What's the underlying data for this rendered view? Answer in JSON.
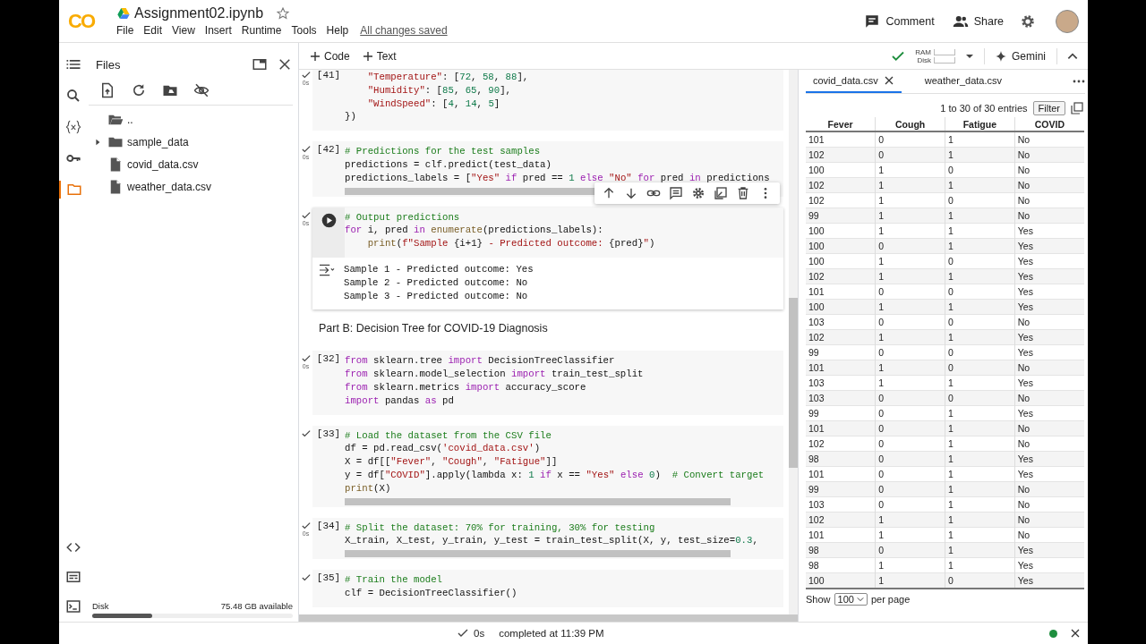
{
  "header": {
    "logo": "CO",
    "title": "Assignment02.ipynb",
    "starred": false,
    "menus": [
      "File",
      "Edit",
      "View",
      "Insert",
      "Runtime",
      "Tools",
      "Help"
    ],
    "save_status": "All changes saved",
    "actions": [
      "Comment",
      "Share"
    ]
  },
  "rail": {
    "items": [
      {
        "selected": false
      },
      {
        "selected": false
      },
      {
        "selected": false
      },
      {
        "selected": true
      }
    ]
  },
  "files": {
    "title": "Files",
    "items": [
      {
        "kind": "parent",
        "name": ".."
      },
      {
        "kind": "folder",
        "name": "sample_data",
        "expanded": false
      },
      {
        "kind": "file",
        "name": "covid_data.csv"
      },
      {
        "kind": "file",
        "name": "weather_data.csv"
      }
    ],
    "disk": {
      "label": "Disk",
      "available": "75.48 GB available",
      "level": 0.3
    }
  },
  "toolbar": {
    "add_buttons": [
      "Code",
      "Text"
    ],
    "connected": true,
    "resources": [
      "RAM",
      "Disk"
    ],
    "gemini": "Gemini"
  },
  "cells": [
    {
      "kind": "code",
      "count": "[41]",
      "time": "0s",
      "ran": true,
      "active": false,
      "hscroll": false,
      "lines": [
        [
          {
            "kind": "string",
            "text": "    \"Temperature\""
          },
          {
            "kind": "plain",
            "text": ": ["
          },
          {
            "kind": "number",
            "text": "72"
          },
          {
            "kind": "plain",
            "text": ", "
          },
          {
            "kind": "number",
            "text": "58"
          },
          {
            "kind": "plain",
            "text": ", "
          },
          {
            "kind": "number",
            "text": "88"
          },
          {
            "kind": "plain",
            "text": "],"
          }
        ],
        [
          {
            "kind": "string",
            "text": "    \"Humidity\""
          },
          {
            "kind": "plain",
            "text": ": ["
          },
          {
            "kind": "number",
            "text": "85"
          },
          {
            "kind": "plain",
            "text": ", "
          },
          {
            "kind": "number",
            "text": "65"
          },
          {
            "kind": "plain",
            "text": ", "
          },
          {
            "kind": "number",
            "text": "90"
          },
          {
            "kind": "plain",
            "text": "],"
          }
        ],
        [
          {
            "kind": "string",
            "text": "    \"WindSpeed\""
          },
          {
            "kind": "plain",
            "text": ": ["
          },
          {
            "kind": "number",
            "text": "4"
          },
          {
            "kind": "plain",
            "text": ", "
          },
          {
            "kind": "number",
            "text": "14"
          },
          {
            "kind": "plain",
            "text": ", "
          },
          {
            "kind": "number",
            "text": "5"
          },
          {
            "kind": "plain",
            "text": "]"
          }
        ],
        [
          {
            "kind": "plain",
            "text": "})"
          }
        ]
      ]
    },
    {
      "kind": "code",
      "count": "[42]",
      "time": "0s",
      "ran": true,
      "active": false,
      "hscroll": true,
      "lines": [
        [
          {
            "kind": "comment",
            "text": "# Predictions for the test samples"
          }
        ],
        [
          {
            "kind": "plain",
            "text": "predictions = clf.predict(test_data)"
          }
        ],
        [
          {
            "kind": "plain",
            "text": "predictions_labels = ["
          },
          {
            "kind": "string",
            "text": "\"Yes\""
          },
          {
            "kind": "keyword",
            "text": " if"
          },
          {
            "kind": "plain",
            "text": " pred == "
          },
          {
            "kind": "number",
            "text": "1"
          },
          {
            "kind": "keyword",
            "text": " else"
          },
          {
            "kind": "string",
            "text": " \"No\""
          },
          {
            "kind": "keyword",
            "text": " for"
          },
          {
            "kind": "plain",
            "text": " pred "
          },
          {
            "kind": "keyword",
            "text": "in"
          },
          {
            "kind": "plain",
            "text": " predictions"
          }
        ]
      ]
    },
    {
      "kind": "code",
      "time": "0s",
      "ran": true,
      "active": true,
      "hscroll": false,
      "lines": [
        [
          {
            "kind": "comment",
            "text": "# Output predictions"
          }
        ],
        [
          {
            "kind": "keyword",
            "text": "for"
          },
          {
            "kind": "plain",
            "text": " i, pred "
          },
          {
            "kind": "keyword",
            "text": "in"
          },
          {
            "kind": "builtin",
            "text": " enumerate"
          },
          {
            "kind": "plain",
            "text": "(predictions_labels):"
          }
        ],
        [
          {
            "kind": "builtin",
            "text": "    print"
          },
          {
            "kind": "plain",
            "text": "("
          },
          {
            "kind": "string",
            "text": "f\"Sample "
          },
          {
            "kind": "plain",
            "text": "{i+1}"
          },
          {
            "kind": "string",
            "text": " - Predicted outcome: "
          },
          {
            "kind": "plain",
            "text": "{pred}"
          },
          {
            "kind": "string",
            "text": "\""
          },
          {
            "kind": "plain",
            "text": ")"
          }
        ]
      ],
      "output": [
        "Sample 1 - Predicted outcome: Yes",
        "Sample 2 - Predicted outcome: No",
        "Sample 3 - Predicted outcome: No"
      ]
    },
    {
      "kind": "markdown",
      "text": "Part B: Decision Tree for COVID-19 Diagnosis"
    },
    {
      "kind": "code",
      "count": "[32]",
      "time": "0s",
      "ran": true,
      "active": false,
      "hscroll": false,
      "lines": [
        [
          {
            "kind": "keyword",
            "text": "from"
          },
          {
            "kind": "plain",
            "text": " sklearn.tree "
          },
          {
            "kind": "keyword",
            "text": "import"
          },
          {
            "kind": "plain",
            "text": " DecisionTreeClassifier"
          }
        ],
        [
          {
            "kind": "keyword",
            "text": "from"
          },
          {
            "kind": "plain",
            "text": " sklearn.model_selection "
          },
          {
            "kind": "keyword",
            "text": "import"
          },
          {
            "kind": "plain",
            "text": " train_test_split"
          }
        ],
        [
          {
            "kind": "keyword",
            "text": "from"
          },
          {
            "kind": "plain",
            "text": " sklearn.metrics "
          },
          {
            "kind": "keyword",
            "text": "import"
          },
          {
            "kind": "plain",
            "text": " accuracy_score"
          }
        ],
        [
          {
            "kind": "keyword",
            "text": "import"
          },
          {
            "kind": "plain",
            "text": " pandas "
          },
          {
            "kind": "keyword",
            "text": "as"
          },
          {
            "kind": "plain",
            "text": " pd"
          }
        ]
      ]
    },
    {
      "kind": "code",
      "count": "[33]",
      "ran": true,
      "active": false,
      "hscroll": true,
      "lines": [
        [
          {
            "kind": "comment",
            "text": "# Load the dataset from the CSV file"
          }
        ],
        [
          {
            "kind": "plain",
            "text": "df = pd.read_csv("
          },
          {
            "kind": "string",
            "text": "'covid_data.csv'"
          },
          {
            "kind": "plain",
            "text": ")"
          }
        ],
        [
          {
            "kind": "plain",
            "text": "X = df[["
          },
          {
            "kind": "string",
            "text": "\"Fever\""
          },
          {
            "kind": "plain",
            "text": ", "
          },
          {
            "kind": "string",
            "text": "\"Cough\""
          },
          {
            "kind": "plain",
            "text": ", "
          },
          {
            "kind": "string",
            "text": "\"Fatigue\""
          },
          {
            "kind": "plain",
            "text": "]]"
          }
        ],
        [
          {
            "kind": "plain",
            "text": "y = df["
          },
          {
            "kind": "string",
            "text": "\"COVID\""
          },
          {
            "kind": "plain",
            "text": "].apply(lambda x: "
          },
          {
            "kind": "number",
            "text": "1"
          },
          {
            "kind": "keyword",
            "text": " if"
          },
          {
            "kind": "plain",
            "text": " x == "
          },
          {
            "kind": "string",
            "text": "\"Yes\""
          },
          {
            "kind": "keyword",
            "text": " else"
          },
          {
            "kind": "number",
            "text": " 0"
          },
          {
            "kind": "plain",
            "text": ")"
          },
          {
            "kind": "comment",
            "text": "  # Convert target"
          }
        ],
        [
          {
            "kind": "builtin",
            "text": "print"
          },
          {
            "kind": "plain",
            "text": "(X)"
          }
        ]
      ]
    },
    {
      "kind": "code",
      "count": "[34]",
      "time": "0s",
      "ran": true,
      "active": false,
      "hscroll": true,
      "lines": [
        [
          {
            "kind": "comment",
            "text": "# Split the dataset: 70% for training, 30% for testing"
          }
        ],
        [
          {
            "kind": "plain",
            "text": "X_train, X_test, y_train, y_test = train_test_split(X, y, test_size="
          },
          {
            "kind": "number",
            "text": "0.3"
          },
          {
            "kind": "plain",
            "text": ","
          }
        ]
      ]
    },
    {
      "kind": "code",
      "count": "[35]",
      "ran": true,
      "active": false,
      "hscroll": false,
      "lines": [
        [
          {
            "kind": "comment",
            "text": "# Train the model"
          }
        ],
        [
          {
            "kind": "plain",
            "text": "clf = DecisionTreeClassifier()"
          }
        ]
      ]
    }
  ],
  "data_panel": {
    "tabs": [
      {
        "label": "covid_data.csv",
        "selected": true
      },
      {
        "label": "weather_data.csv",
        "selected": false
      }
    ],
    "entries": "1 to 30 of 30 entries",
    "filter": "Filter",
    "columns": [
      "Fever",
      "Cough",
      "Fatigue",
      "COVID"
    ],
    "rows": [
      [
        "101",
        "0",
        "1",
        "No"
      ],
      [
        "102",
        "0",
        "1",
        "No"
      ],
      [
        "100",
        "1",
        "0",
        "No"
      ],
      [
        "102",
        "1",
        "1",
        "No"
      ],
      [
        "102",
        "1",
        "0",
        "No"
      ],
      [
        "99",
        "1",
        "1",
        "No"
      ],
      [
        "100",
        "1",
        "1",
        "Yes"
      ],
      [
        "100",
        "0",
        "1",
        "Yes"
      ],
      [
        "100",
        "1",
        "0",
        "Yes"
      ],
      [
        "102",
        "1",
        "1",
        "Yes"
      ],
      [
        "101",
        "0",
        "0",
        "Yes"
      ],
      [
        "100",
        "1",
        "1",
        "Yes"
      ],
      [
        "103",
        "0",
        "0",
        "No"
      ],
      [
        "102",
        "1",
        "1",
        "Yes"
      ],
      [
        "99",
        "0",
        "0",
        "Yes"
      ],
      [
        "101",
        "1",
        "0",
        "No"
      ],
      [
        "103",
        "1",
        "1",
        "Yes"
      ],
      [
        "103",
        "0",
        "0",
        "No"
      ],
      [
        "99",
        "0",
        "1",
        "Yes"
      ],
      [
        "101",
        "0",
        "1",
        "No"
      ],
      [
        "102",
        "0",
        "1",
        "No"
      ],
      [
        "98",
        "0",
        "1",
        "Yes"
      ],
      [
        "101",
        "0",
        "1",
        "Yes"
      ],
      [
        "99",
        "0",
        "1",
        "No"
      ],
      [
        "103",
        "0",
        "1",
        "No"
      ],
      [
        "102",
        "1",
        "1",
        "No"
      ],
      [
        "101",
        "1",
        "1",
        "No"
      ],
      [
        "98",
        "0",
        "1",
        "Yes"
      ],
      [
        "98",
        "1",
        "1",
        "Yes"
      ],
      [
        "100",
        "1",
        "0",
        "Yes"
      ]
    ],
    "show_label": "Show",
    "page_size": "100",
    "per_page_label": "per page"
  },
  "status_bar": {
    "time": "0s",
    "message": "completed at 11:39 PM",
    "connected": true
  }
}
